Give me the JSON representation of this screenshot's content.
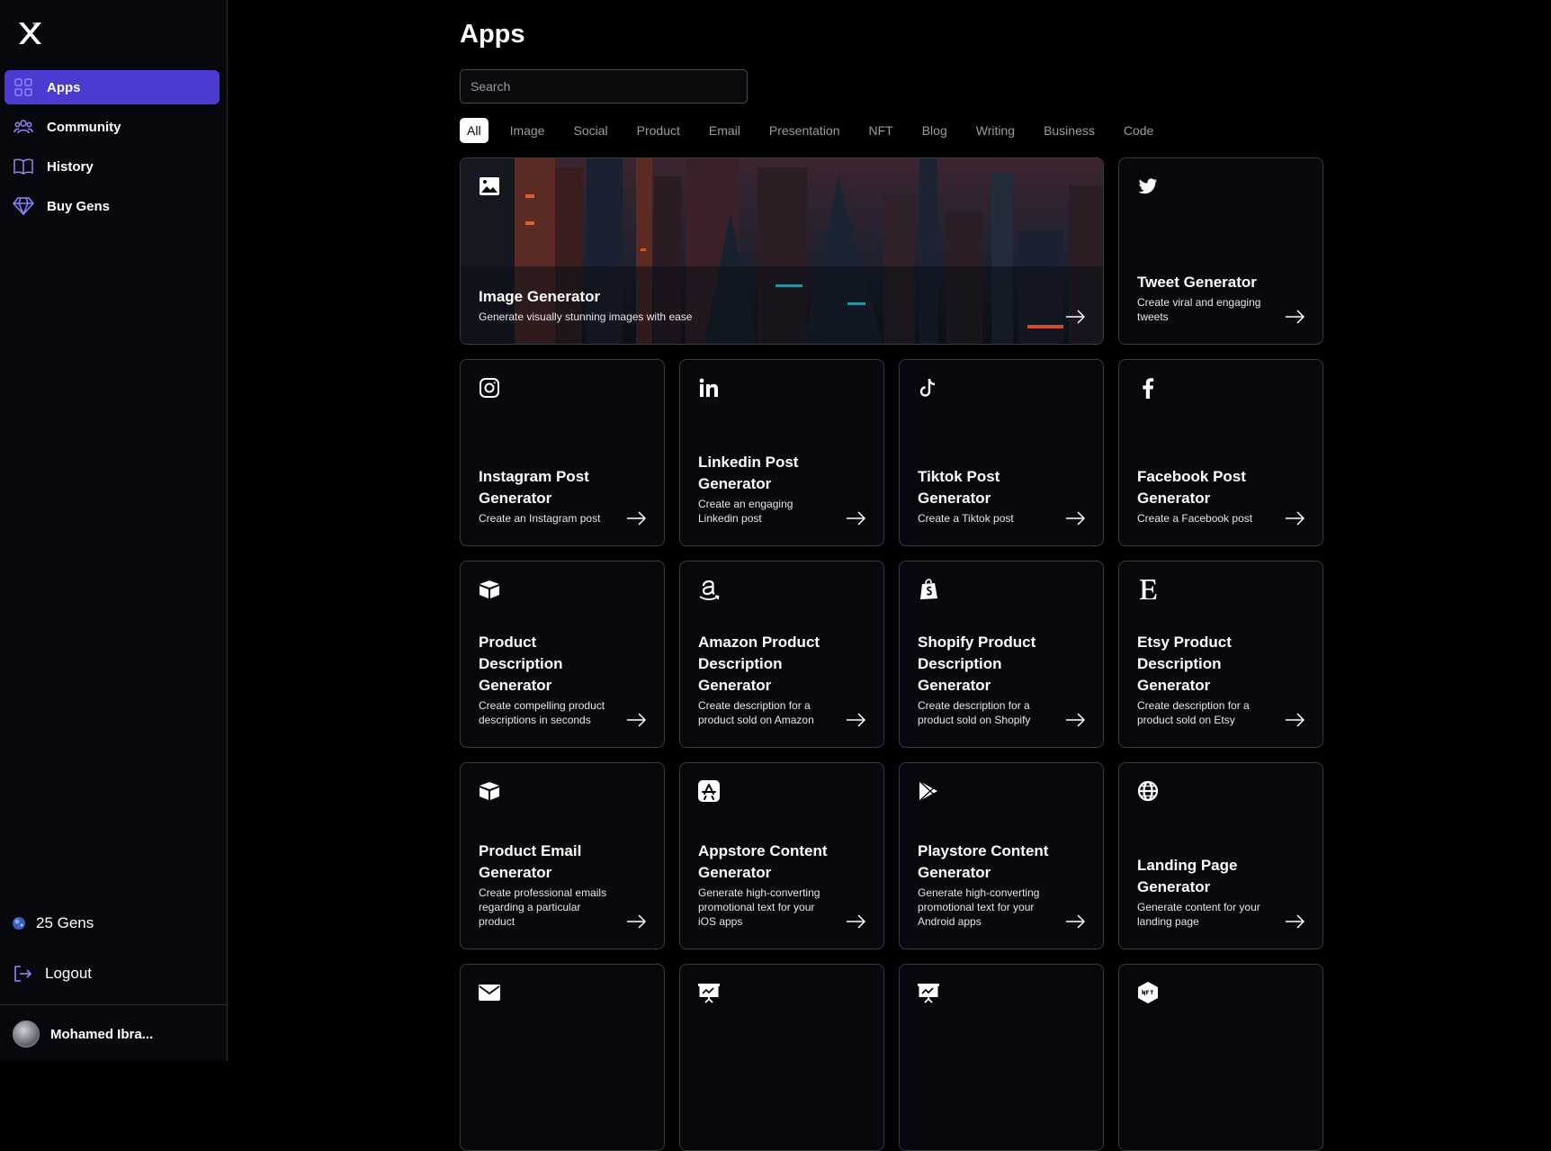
{
  "sidebar": {
    "nav": [
      {
        "label": "Apps",
        "icon": "grid-icon",
        "active": true
      },
      {
        "label": "Community",
        "icon": "users-icon",
        "active": false
      },
      {
        "label": "History",
        "icon": "book-icon",
        "active": false
      },
      {
        "label": "Buy Gens",
        "icon": "diamond-icon",
        "active": false
      }
    ],
    "gens_label": "25 Gens",
    "logout_label": "Logout",
    "user_name": "Mohamed Ibra..."
  },
  "main": {
    "title": "Apps",
    "search_placeholder": "Search",
    "tabs": [
      "All",
      "Image",
      "Social",
      "Product",
      "Email",
      "Presentation",
      "NFT",
      "Blog",
      "Writing",
      "Business",
      "Code"
    ],
    "active_tab": "All",
    "cards": [
      {
        "title": "Image Generator",
        "desc": "Generate visually stunning images with ease",
        "icon": "image-icon"
      },
      {
        "title": "Tweet Generator",
        "desc": "Create viral and engaging tweets",
        "icon": "twitter-icon"
      },
      {
        "title": "Instagram Post Generator",
        "desc": "Create an Instagram post",
        "icon": "instagram-icon"
      },
      {
        "title": "Linkedin Post Generator",
        "desc": "Create an engaging Linkedin post",
        "icon": "linkedin-icon"
      },
      {
        "title": "Tiktok Post Generator",
        "desc": "Create a Tiktok post",
        "icon": "tiktok-icon"
      },
      {
        "title": "Facebook Post Generator",
        "desc": "Create a Facebook post",
        "icon": "facebook-icon"
      },
      {
        "title": "Product Description Generator",
        "desc": "Create compelling product descriptions in seconds",
        "icon": "box-icon"
      },
      {
        "title": "Amazon Product Description Generator",
        "desc": "Create description for a product sold on Amazon",
        "icon": "amazon-icon"
      },
      {
        "title": "Shopify Product Description Generator",
        "desc": "Create description for a product sold on Shopify",
        "icon": "shopify-icon"
      },
      {
        "title": "Etsy Product Description Generator",
        "desc": "Create description for a product sold on Etsy",
        "icon": "etsy-icon"
      },
      {
        "title": "Product Email Generator",
        "desc": "Create professional emails regarding a particular product",
        "icon": "box-icon"
      },
      {
        "title": "Appstore Content Generator",
        "desc": "Generate high-converting promotional text for your iOS apps",
        "icon": "appstore-icon"
      },
      {
        "title": "Playstore Content Generator",
        "desc": "Generate high-converting promotional text for your Android apps",
        "icon": "playstore-icon"
      },
      {
        "title": "Landing Page Generator",
        "desc": "Generate content for your landing page",
        "icon": "globe-icon"
      },
      {
        "title": "",
        "desc": "",
        "icon": "envelope-icon"
      },
      {
        "title": "",
        "desc": "",
        "icon": "presentation-icon"
      },
      {
        "title": "",
        "desc": "",
        "icon": "presentation-icon"
      },
      {
        "title": "",
        "desc": "",
        "icon": "nft-icon"
      }
    ]
  },
  "colors": {
    "accent": "#4b3bd1",
    "background": "#000000",
    "sidebar": "#07080d",
    "border": "#3a3b42"
  }
}
